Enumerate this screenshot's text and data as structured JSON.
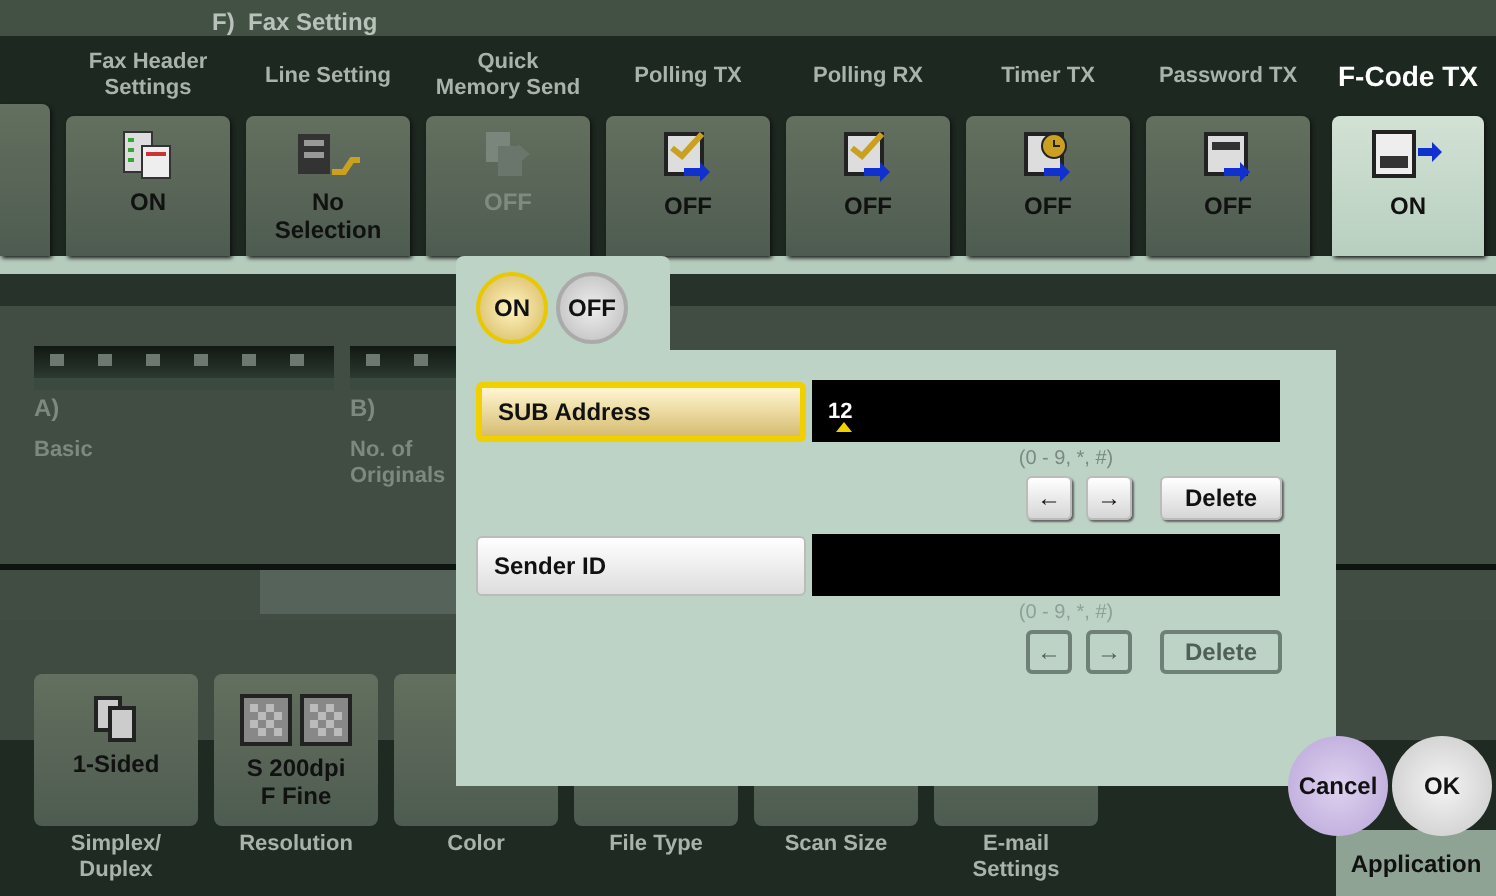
{
  "fax_setting_group": {
    "label": "F)  Fax Setting"
  },
  "function_tiles": [
    {
      "caption": "Fax Header\nSettings",
      "value": "ON",
      "selected": false,
      "disabled": false
    },
    {
      "caption": "Line Setting",
      "value": "No\nSelection",
      "selected": false,
      "disabled": false
    },
    {
      "caption": "Quick\nMemory Send",
      "value": "OFF",
      "selected": false,
      "disabled": true
    },
    {
      "caption": "Polling TX",
      "value": "OFF",
      "selected": false,
      "disabled": false
    },
    {
      "caption": "Polling RX",
      "value": "OFF",
      "selected": false,
      "disabled": false
    },
    {
      "caption": "Timer TX",
      "value": "OFF",
      "selected": false,
      "disabled": false
    },
    {
      "caption": "Password TX",
      "value": "OFF",
      "selected": false,
      "disabled": false
    },
    {
      "caption": "F-Code TX",
      "value": "ON",
      "selected": true,
      "disabled": false
    }
  ],
  "tabs": [
    {
      "letter": "A)",
      "label": "Basic",
      "disabled": true
    },
    {
      "letter": "B)",
      "label": "No. of\nOriginals",
      "disabled": true
    }
  ],
  "scan_tiles": [
    {
      "caption": "Simplex/\nDuplex",
      "value": "1-Sided"
    },
    {
      "caption": "Resolution",
      "value": "S 200dpi\nF Fine"
    },
    {
      "caption": "Color"
    },
    {
      "caption": "File Type"
    },
    {
      "caption": "Scan Size"
    },
    {
      "caption": "E-mail\nSettings"
    }
  ],
  "application_button": {
    "label": "Application"
  },
  "dialog": {
    "toggle": [
      {
        "label": "ON",
        "selected": true
      },
      {
        "label": "OFF",
        "selected": false
      }
    ],
    "fields": [
      {
        "label": "SUB Address",
        "selected": true,
        "disabled": false,
        "value": "12",
        "hint": "(0 - 9, *, #)",
        "buttons": [
          "←",
          "→",
          "Delete"
        ]
      },
      {
        "label": "Sender ID",
        "selected": false,
        "disabled": true,
        "hint": "(0 - 9, *, #)",
        "buttons": [
          "←",
          "→",
          "Delete"
        ]
      }
    ],
    "buttons": [
      {
        "label": "Cancel",
        "kind": "cancel"
      },
      {
        "label": "OK",
        "kind": "ok"
      }
    ]
  }
}
